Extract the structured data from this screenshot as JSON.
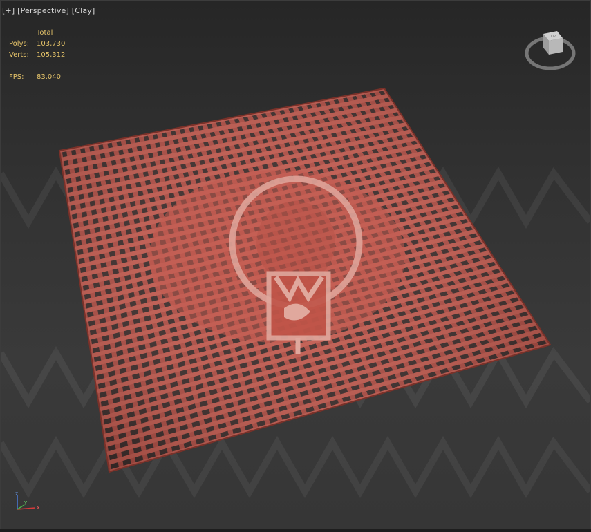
{
  "viewport": {
    "label_parts": [
      "[+]",
      "[Perspective]",
      "[Clay]"
    ]
  },
  "stats": {
    "header": "Total",
    "polys_label": "Polys:",
    "polys_value": "103,730",
    "verts_label": "Verts:",
    "verts_value": "105,312",
    "fps_label": "FPS:",
    "fps_value": "83.040"
  },
  "colors": {
    "stats_text": "#e6c46a",
    "mesh_base": "#a9473f",
    "mesh_strand": "#c4574c",
    "logo_overlay": "#e0a89d"
  },
  "icons": {
    "viewcube": "viewcube-icon",
    "axis": "axis-tripod-icon",
    "logo": "lightbulb-logo-icon"
  },
  "viewcube": {
    "face_label": "TOP"
  },
  "axis": {
    "x_label": "x",
    "y_label": "y",
    "z_label": "z"
  }
}
